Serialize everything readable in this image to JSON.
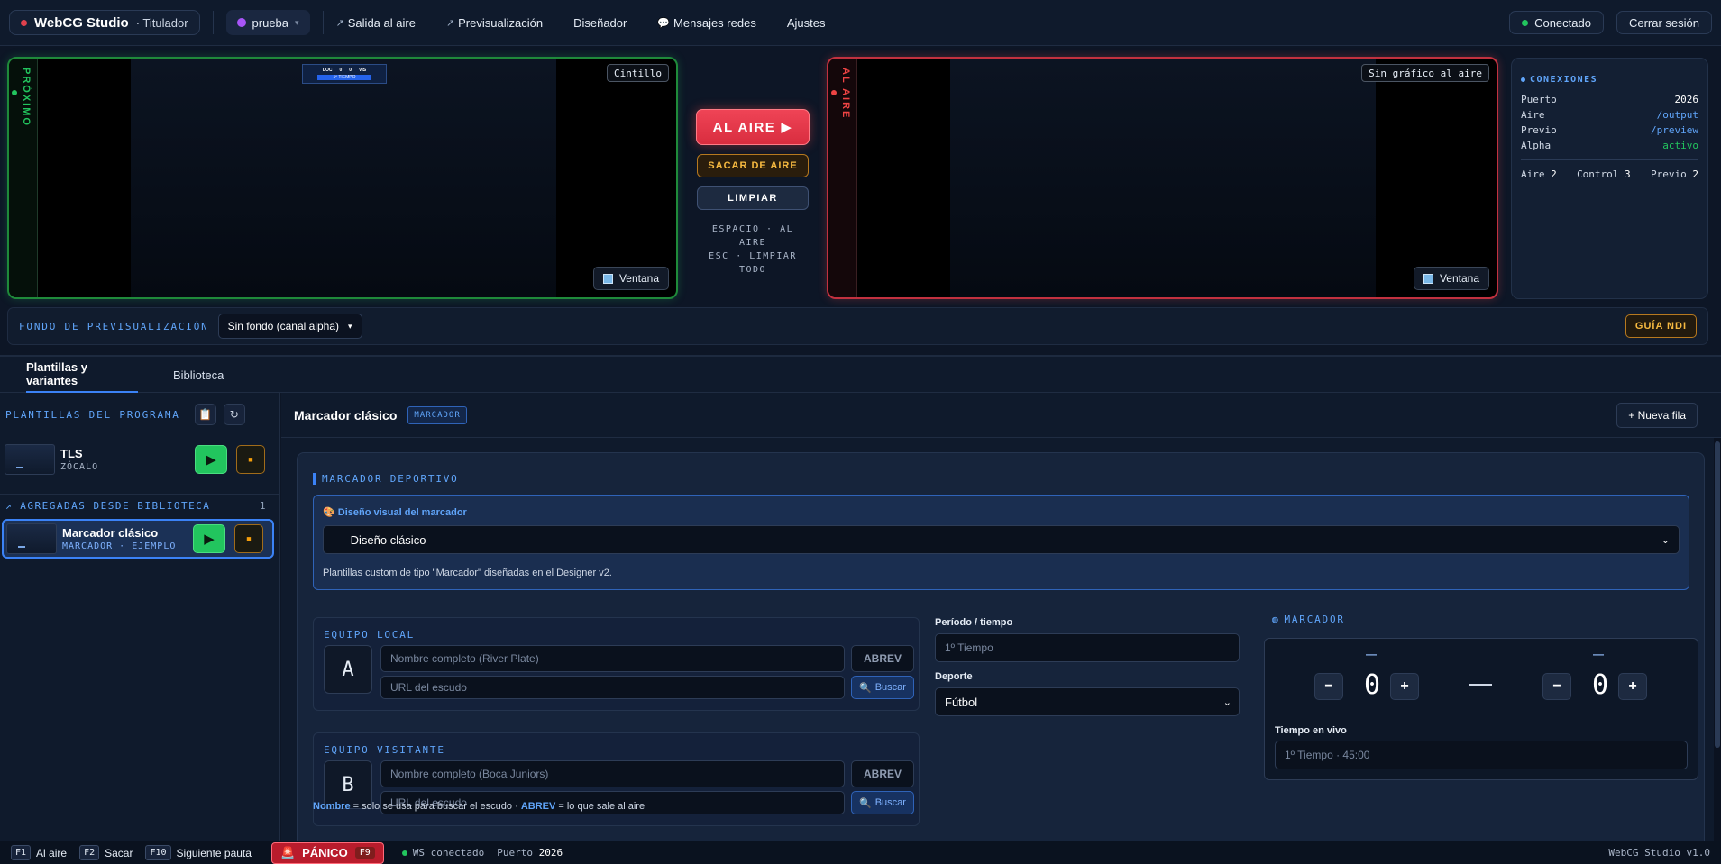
{
  "topbar": {
    "brand_name": "WebCG Studio",
    "brand_sub": "· Titulador",
    "project": "prueba",
    "nav": [
      {
        "label": "Salida al aire",
        "icon": "↗"
      },
      {
        "label": "Previsualización",
        "icon": "↗"
      },
      {
        "label": "Diseñador",
        "icon": ""
      },
      {
        "label": "Mensajes redes",
        "icon": "💬"
      },
      {
        "label": "Ajustes",
        "icon": ""
      }
    ],
    "status": "Conectado",
    "logout": "Cerrar sesión"
  },
  "preview_monitor": {
    "label": "PRÓXIMO",
    "badge": "Cintillo",
    "window_btn": "Ventana",
    "mini_score": {
      "home": "LOC",
      "home_score": "0",
      "away": "VIS",
      "away_score": "0",
      "period": "1º TIEMPO"
    }
  },
  "air_monitor": {
    "label": "AL AIRE",
    "badge": "Sin gráfico al aire",
    "window_btn": "Ventana"
  },
  "controls": {
    "air_label": "AL AIRE",
    "out_label": "SACAR DE AIRE",
    "clear_label": "LIMPIAR",
    "hint_line1": "ESPACIO · AL AIRE",
    "hint_line2": "ESC · LIMPIAR TODO"
  },
  "connections": {
    "title": "CONEXIONES",
    "rows": [
      {
        "key": "Puerto",
        "value": "2026"
      },
      {
        "key": "Aire",
        "value": "/output"
      },
      {
        "key": "Previo",
        "value": "/preview"
      },
      {
        "key": "Alpha",
        "value": "activo"
      }
    ],
    "stats": [
      {
        "key": "Aire",
        "value": "2"
      },
      {
        "key": "Control",
        "value": "3"
      },
      {
        "key": "Previo",
        "value": "2"
      }
    ]
  },
  "preview_bg": {
    "label": "FONDO DE PREVISUALIZACIÓN",
    "selected": "Sin fondo (canal alpha)",
    "ndi_label": "GUÍA NDI"
  },
  "tabs": [
    "Plantillas y variantes",
    "Biblioteca"
  ],
  "sidebar": {
    "title": "PLANTILLAS DEL PROGRAMA",
    "templates": [
      {
        "name": "TLS",
        "sub": "ZÓCALO"
      }
    ],
    "added_title": "↗ AGREGADAS DESDE BIBLIOTECA",
    "added_count": "1",
    "added": [
      {
        "name": "Marcador clásico",
        "sub": "MARCADOR · EJEMPLO"
      }
    ]
  },
  "main": {
    "title": "Marcador clásico",
    "badge": "MARCADOR",
    "new_row": "+ Nueva fila",
    "section_title": "MARCADOR DEPORTIVO",
    "design_label": "Diseño visual del marcador",
    "design_selected": "— Diseño clásico —",
    "design_note": "Plantillas custom de tipo \"Marcador\" diseñadas en el Designer v2.",
    "home": {
      "label": "EQUIPO LOCAL",
      "letter": "A",
      "name_placeholder": "Nombre completo (River Plate)",
      "abrev": "ABREV",
      "url_placeholder": "URL del escudo",
      "find": "Buscar"
    },
    "away": {
      "label": "EQUIPO VISITANTE",
      "letter": "B",
      "name_placeholder": "Nombre completo (Boca Juniors)",
      "abrev": "ABREV",
      "url_placeholder": "URL del escudo",
      "find": "Buscar"
    },
    "period_label": "Período / tiempo",
    "period_placeholder": "1º Tiempo",
    "sport_label": "Deporte",
    "sport_selected": "Fútbol",
    "scoreboard": {
      "label": "MARCADOR",
      "home_abbrev": "—",
      "away_abbrev": "—",
      "home_score": "0",
      "away_score": "0",
      "live_label": "Tiempo en vivo",
      "live_placeholder": "1º Tiempo · 45:00"
    },
    "foot_name": "Nombre",
    "foot_mid": " = solo se usa para buscar el escudo · ",
    "foot_abrev": "ABREV",
    "foot_end": " = lo que sale al aire"
  },
  "statusbar": {
    "shortcuts": [
      {
        "key": "F1",
        "label": "Al aire"
      },
      {
        "key": "F2",
        "label": "Sacar"
      },
      {
        "key": "F10",
        "label": "Siguiente pauta"
      }
    ],
    "panic": "PÁNICO",
    "panic_key": "F9",
    "ws": "WS conectado",
    "port_label": "Puerto",
    "port": "2026",
    "version": "WebCG Studio v1.0"
  },
  "colors": {
    "accent": "#3b82f6",
    "live": "#ef4444",
    "next": "#22c55e",
    "warning": "#f59e0b"
  }
}
